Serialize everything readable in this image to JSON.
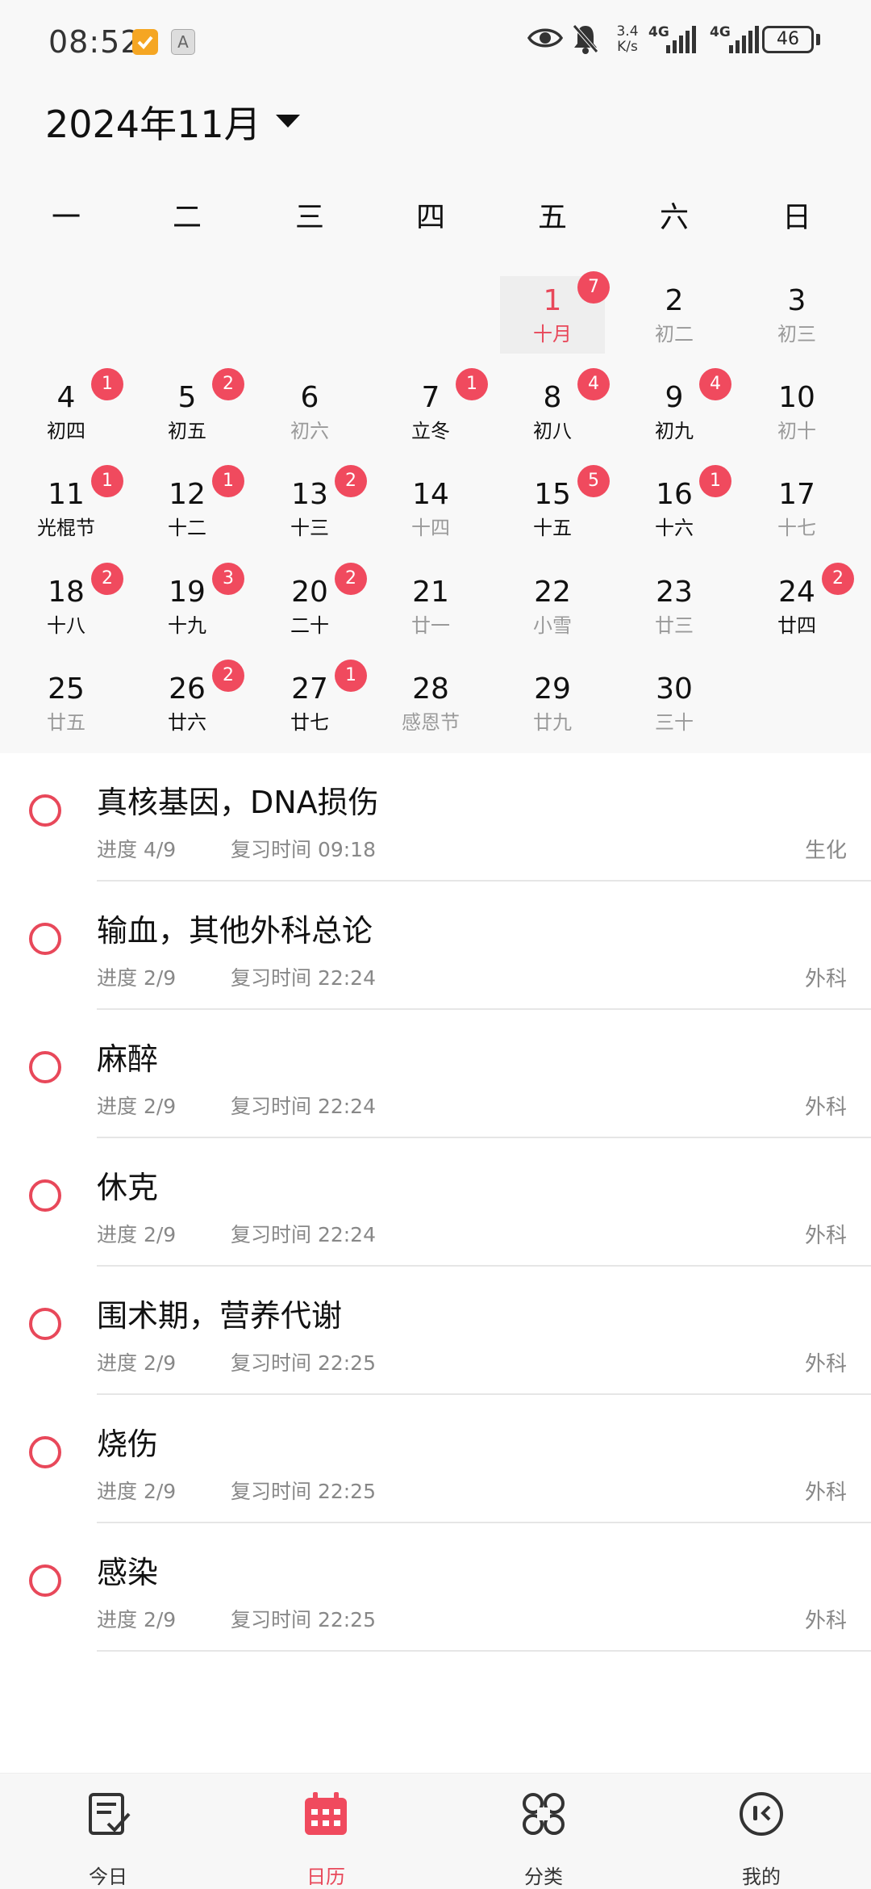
{
  "status_bar": {
    "time": "08:52",
    "speed_value": "3.4",
    "speed_unit": "K/s",
    "network_1": "4G",
    "network_2": "4G",
    "battery": "46"
  },
  "calendar": {
    "month_title": "2024年11月",
    "weekdays": [
      "一",
      "二",
      "三",
      "四",
      "五",
      "六",
      "日"
    ],
    "selected_day": 1,
    "first_weekday_index": 4,
    "days": [
      {
        "day": "1",
        "lunar": "十月",
        "badge": "7",
        "muted": false
      },
      {
        "day": "2",
        "lunar": "初二",
        "badge": "",
        "muted": true
      },
      {
        "day": "3",
        "lunar": "初三",
        "badge": "",
        "muted": true
      },
      {
        "day": "4",
        "lunar": "初四",
        "badge": "1",
        "muted": false
      },
      {
        "day": "5",
        "lunar": "初五",
        "badge": "2",
        "muted": false
      },
      {
        "day": "6",
        "lunar": "初六",
        "badge": "",
        "muted": true
      },
      {
        "day": "7",
        "lunar": "立冬",
        "badge": "1",
        "muted": false
      },
      {
        "day": "8",
        "lunar": "初八",
        "badge": "4",
        "muted": false
      },
      {
        "day": "9",
        "lunar": "初九",
        "badge": "4",
        "muted": false
      },
      {
        "day": "10",
        "lunar": "初十",
        "badge": "",
        "muted": true
      },
      {
        "day": "11",
        "lunar": "光棍节",
        "badge": "1",
        "muted": false
      },
      {
        "day": "12",
        "lunar": "十二",
        "badge": "1",
        "muted": false
      },
      {
        "day": "13",
        "lunar": "十三",
        "badge": "2",
        "muted": false
      },
      {
        "day": "14",
        "lunar": "十四",
        "badge": "",
        "muted": true
      },
      {
        "day": "15",
        "lunar": "十五",
        "badge": "5",
        "muted": false
      },
      {
        "day": "16",
        "lunar": "十六",
        "badge": "1",
        "muted": false
      },
      {
        "day": "17",
        "lunar": "十七",
        "badge": "",
        "muted": true
      },
      {
        "day": "18",
        "lunar": "十八",
        "badge": "2",
        "muted": false
      },
      {
        "day": "19",
        "lunar": "十九",
        "badge": "3",
        "muted": false
      },
      {
        "day": "20",
        "lunar": "二十",
        "badge": "2",
        "muted": false
      },
      {
        "day": "21",
        "lunar": "廿一",
        "badge": "",
        "muted": true
      },
      {
        "day": "22",
        "lunar": "小雪",
        "badge": "",
        "muted": true
      },
      {
        "day": "23",
        "lunar": "廿三",
        "badge": "",
        "muted": true
      },
      {
        "day": "24",
        "lunar": "廿四",
        "badge": "2",
        "muted": false
      },
      {
        "day": "25",
        "lunar": "廿五",
        "badge": "",
        "muted": true
      },
      {
        "day": "26",
        "lunar": "廿六",
        "badge": "2",
        "muted": false
      },
      {
        "day": "27",
        "lunar": "廿七",
        "badge": "1",
        "muted": false
      },
      {
        "day": "28",
        "lunar": "感恩节",
        "badge": "",
        "muted": true
      },
      {
        "day": "29",
        "lunar": "廿九",
        "badge": "",
        "muted": true
      },
      {
        "day": "30",
        "lunar": "三十",
        "badge": "",
        "muted": true
      }
    ]
  },
  "tasks": [
    {
      "title": "真核基因，DNA损伤",
      "progress": "进度 4/9",
      "review": "复习时间 09:18",
      "category": "生化"
    },
    {
      "title": "输血，其他外科总论",
      "progress": "进度 2/9",
      "review": "复习时间 22:24",
      "category": "外科"
    },
    {
      "title": "麻醉",
      "progress": "进度 2/9",
      "review": "复习时间 22:24",
      "category": "外科"
    },
    {
      "title": "休克",
      "progress": "进度 2/9",
      "review": "复习时间 22:24",
      "category": "外科"
    },
    {
      "title": "围术期，营养代谢",
      "progress": "进度 2/9",
      "review": "复习时间 22:25",
      "category": "外科"
    },
    {
      "title": "烧伤",
      "progress": "进度 2/9",
      "review": "复习时间 22:25",
      "category": "外科"
    },
    {
      "title": "感染",
      "progress": "进度 2/9",
      "review": "复习时间 22:25",
      "category": "外科"
    }
  ],
  "nav": {
    "items": [
      {
        "label": "今日",
        "icon": "checklist-icon"
      },
      {
        "label": "日历",
        "icon": "calendar-icon"
      },
      {
        "label": "分类",
        "icon": "command-icon"
      },
      {
        "label": "我的",
        "icon": "face-icon"
      }
    ],
    "active_index": 1
  },
  "colors": {
    "accent": "#e8485a",
    "badge": "#f04a5e",
    "muted_text": "#9a9a9a"
  }
}
